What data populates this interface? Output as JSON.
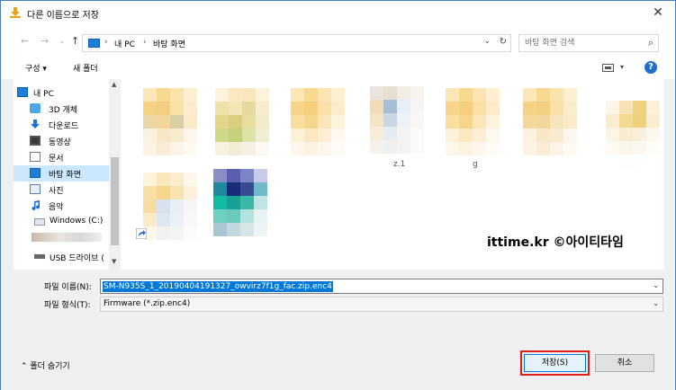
{
  "window": {
    "title": "다른 이름으로 저장",
    "close_label": "✕"
  },
  "nav": {
    "back": "←",
    "forward": "→",
    "recent": "⌄",
    "up": "↑"
  },
  "address": {
    "crumbs": [
      "내 PC",
      "바탕 화면"
    ],
    "separators": [
      "›",
      "›"
    ],
    "dropdown": "⌄",
    "refresh": "↻"
  },
  "search": {
    "placeholder": "바탕 화면 검색",
    "icon": "⌕"
  },
  "toolbar": {
    "organize": "구성 ▾",
    "new_folder": "새 폴더",
    "view_dd": "▾",
    "help": "?"
  },
  "sidebar": {
    "items": [
      {
        "label": "내 PC",
        "icon": "pc-icon"
      },
      {
        "label": "3D 개체",
        "icon": "3d-objects-icon"
      },
      {
        "label": "다운로드",
        "icon": "download-icon"
      },
      {
        "label": "동영상",
        "icon": "video-icon"
      },
      {
        "label": "문서",
        "icon": "document-icon"
      },
      {
        "label": "바탕 화면",
        "icon": "desktop-icon",
        "selected": true
      },
      {
        "label": "사진",
        "icon": "pictures-icon"
      },
      {
        "label": "음악",
        "icon": "music-icon"
      },
      {
        "label": "Windows (C:)",
        "icon": "drive-icon"
      },
      {
        "label": "",
        "icon": "blurred-icon"
      },
      {
        "label": "USB 드라이브 (",
        "icon": "usb-icon"
      }
    ],
    "scroll_up": "▲",
    "scroll_down": "▼"
  },
  "files": {
    "labels": [
      "z.1",
      "g"
    ],
    "watermark": "ittime.kr ©아이티타임"
  },
  "form": {
    "filename_label": "파일 이름(N):",
    "filename_value": "SM-N935S_1_20190404191327_owvirz7f1g_fac.zip.enc4",
    "filetype_label": "파일 형식(T):",
    "filetype_value": "Firmware (*.zip.enc4)",
    "dropdown": "⌄",
    "hide_folders": "⌃  폴더 숨기기",
    "save_label": "저장(S)",
    "cancel_label": "취소"
  },
  "colors": {
    "accent": "#0078d7",
    "selection": "#cce8ff",
    "highlight_box": "#e31b1b"
  }
}
